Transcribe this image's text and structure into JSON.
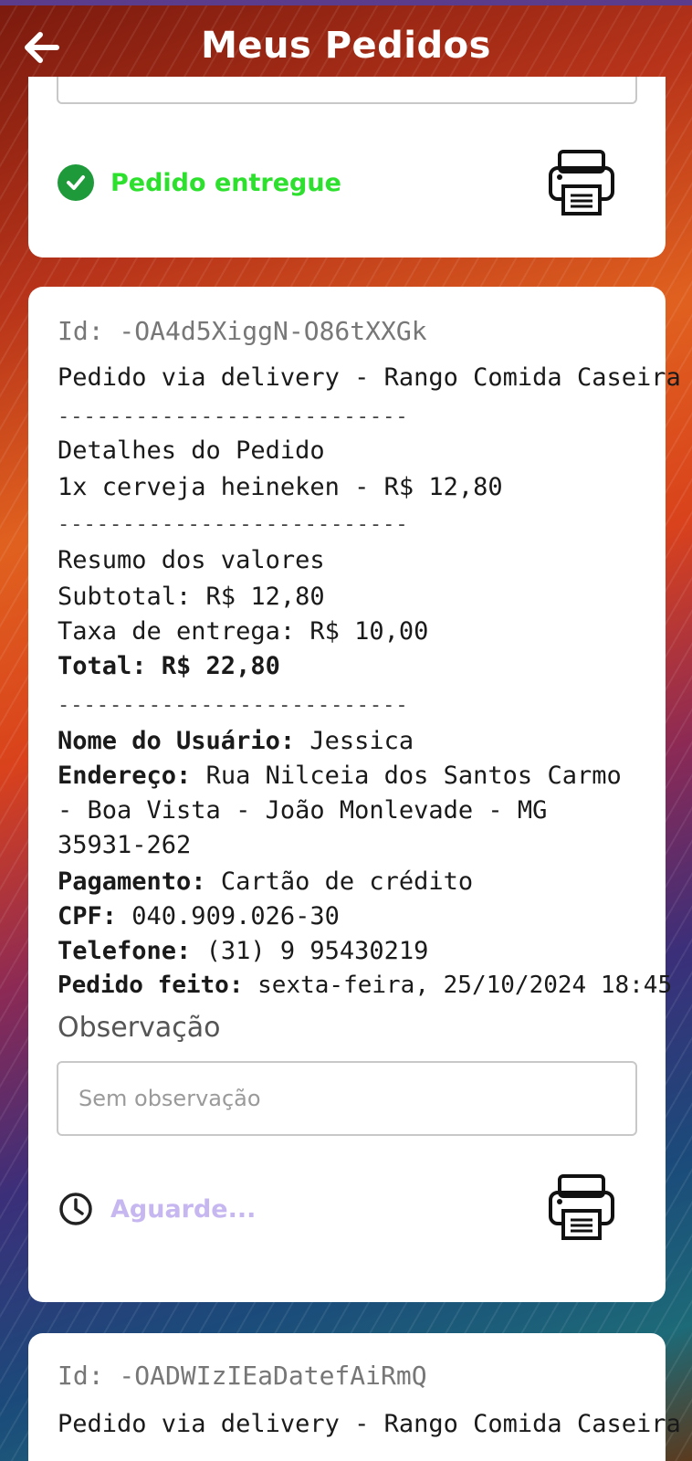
{
  "appbar": {
    "title": "Meus Pedidos",
    "back_icon": "arrow-left-icon"
  },
  "orders": [
    {
      "status": {
        "text": "Pedido entregue",
        "icon": "check-circle-icon",
        "color": "#2ee02e"
      }
    },
    {
      "id": "Id: -OA4d5XiggN-O86tXXGk",
      "title": "Pedido via delivery - Rango Comida Caseira",
      "separator": "---------------------------",
      "details_heading": "Detalhes do Pedido",
      "items": [
        "1x cerveja heineken - R$ 12,80"
      ],
      "summary_heading": "Resumo dos valores",
      "subtotal": "Subtotal: R$ 12,80",
      "fee": "Taxa de entrega: R$ 10,00",
      "total": "Total: R$ 22,80",
      "user": {
        "label": "Nome do Usuário:",
        "value": " Jessica"
      },
      "address": {
        "label": "Endereço:",
        "value_line1": " Rua Nilceia dos Santos Carmo",
        "value_line2": "- Boa Vista - João Monlevade - MG",
        "value_line3": "35931-262"
      },
      "payment": {
        "label": "Pagamento:",
        "value": " Cartão de crédito"
      },
      "cpf": {
        "label": "CPF:",
        "value": " 040.909.026-30"
      },
      "phone": {
        "label": "Telefone:",
        "value": " (31) 9 95430219"
      },
      "placed": {
        "label": "Pedido feito:",
        "value": " sexta-feira, 25/10/2024 18:45"
      },
      "observation_label": "Observação",
      "observation_placeholder": "Sem observação",
      "status": {
        "text": "Aguarde...",
        "icon": "clock-icon",
        "color": "#c7b7f0"
      }
    },
    {
      "id": "Id: -OADWIzIEaDatefAiRmQ",
      "title": "Pedido via delivery - Rango Comida Caseira"
    }
  ],
  "printer_icon": "printer-icon"
}
